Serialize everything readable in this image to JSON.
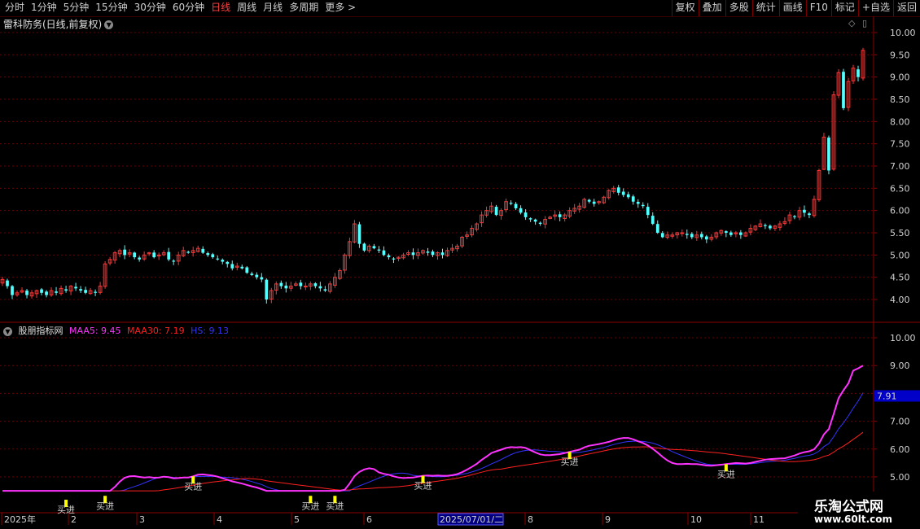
{
  "toolbar": {
    "tabs": [
      "分时",
      "1分钟",
      "5分钟",
      "15分钟",
      "30分钟",
      "60分钟",
      "日线",
      "周线",
      "月线",
      "多周期",
      "更多 >"
    ],
    "active_tab": "日线",
    "right_buttons": [
      "复权",
      "叠加",
      "多股",
      "统计",
      "画线",
      "F10",
      "标记",
      "+自选",
      "返回"
    ]
  },
  "main_panel": {
    "title": "雷科防务(日线,前复权)",
    "price_axis": [
      "10.00",
      "9.50",
      "9.00",
      "8.50",
      "8.00",
      "7.50",
      "7.00",
      "6.50",
      "6.00",
      "5.50",
      "5.00",
      "4.50",
      "4.00"
    ]
  },
  "indicator_panel": {
    "name": "股朋指标网",
    "legend": [
      {
        "label": "MAA5: 9.45",
        "color": "#ff33ff"
      },
      {
        "label": "MAA30: 7.19",
        "color": "#ff2020"
      },
      {
        "label": "HS: 9.13",
        "color": "#3333ff"
      }
    ],
    "axis": [
      "10.00",
      "9.00",
      "8.00",
      "7.00",
      "6.00",
      "5.00"
    ],
    "current_marker": "7.91",
    "signal_label": "买进"
  },
  "date_axis": {
    "labels": [
      "2025年",
      "2",
      "3",
      "4",
      "5",
      "6",
      "8",
      "9",
      "10",
      "11"
    ],
    "highlight": "2025/07/01/二"
  },
  "watermark": {
    "line1": "乐淘公式网",
    "line2": "www.60lt.com"
  },
  "colors": {
    "up": "#ff3232",
    "down": "#54ffff",
    "grid": "#6e0000",
    "border": "#8b0000"
  },
  "chart_data": {
    "type": "candlestick",
    "ylim": [
      3.8,
      10.1
    ],
    "closes": [
      4.45,
      4.3,
      4.1,
      4.15,
      4.2,
      4.1,
      4.15,
      4.2,
      4.15,
      4.1,
      4.2,
      4.15,
      4.25,
      4.2,
      4.3,
      4.25,
      4.2,
      4.15,
      4.2,
      4.15,
      4.3,
      4.8,
      4.9,
      5.05,
      5.1,
      5.0,
      5.05,
      4.95,
      4.9,
      5.0,
      5.05,
      4.95,
      5.0,
      5.05,
      4.9,
      4.85,
      5.0,
      5.1,
      5.05,
      5.1,
      5.15,
      5.05,
      5.0,
      4.95,
      4.9,
      4.85,
      4.8,
      4.7,
      4.75,
      4.7,
      4.6,
      4.55,
      4.5,
      4.45,
      4.0,
      4.2,
      4.35,
      4.3,
      4.25,
      4.3,
      4.35,
      4.3,
      4.3,
      4.35,
      4.3,
      4.25,
      4.2,
      4.35,
      4.5,
      4.65,
      5.0,
      5.3,
      5.7,
      5.25,
      5.1,
      5.2,
      5.15,
      5.1,
      5.0,
      4.95,
      4.9,
      4.95,
      5.0,
      5.05,
      5.0,
      5.05,
      5.1,
      5.05,
      5.0,
      5.05,
      5.0,
      5.1,
      5.15,
      5.2,
      5.4,
      5.45,
      5.6,
      5.7,
      5.9,
      6.0,
      6.1,
      5.9,
      6.0,
      6.2,
      6.15,
      6.05,
      5.95,
      5.85,
      5.8,
      5.75,
      5.7,
      5.8,
      5.85,
      5.9,
      5.85,
      5.9,
      6.0,
      6.05,
      6.1,
      6.25,
      6.2,
      6.15,
      6.2,
      6.3,
      6.45,
      6.5,
      6.4,
      6.35,
      6.3,
      6.2,
      6.15,
      6.1,
      5.9,
      5.7,
      5.5,
      5.4,
      5.45,
      5.45,
      5.5,
      5.5,
      5.45,
      5.4,
      5.45,
      5.4,
      5.35,
      5.4,
      5.5,
      5.55,
      5.5,
      5.45,
      5.5,
      5.45,
      5.5,
      5.6,
      5.65,
      5.7,
      5.65,
      5.6,
      5.65,
      5.7,
      5.75,
      5.9,
      5.85,
      6.0,
      5.95,
      5.9,
      6.25,
      6.9,
      7.65,
      6.9,
      8.6,
      9.1,
      8.3,
      8.9,
      9.2,
      9.0,
      9.6
    ]
  }
}
